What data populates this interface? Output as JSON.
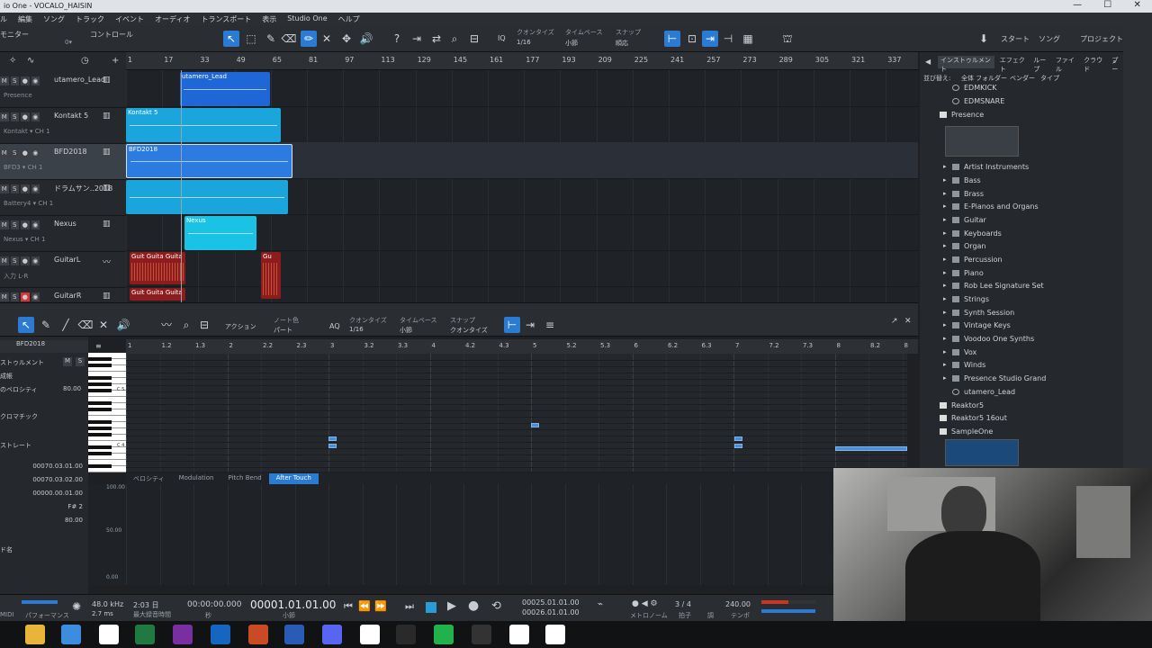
{
  "window": {
    "title": "io One - VOCALO_HAISIN"
  },
  "menu": [
    "ル",
    "編集",
    "ソング",
    "トラック",
    "イベント",
    "オーディオ",
    "トランスポート",
    "表示",
    "Studio One",
    "ヘルプ"
  ],
  "toolbar": {
    "monitor": "モニター",
    "control": "コントロール",
    "quantize_label": "クオンタイズ",
    "quantize_value": "1/16",
    "timebase_label": "タイムベース",
    "timebase_value": "小節",
    "snap_label": "スナップ",
    "snap_value": "順応",
    "start": "スタート",
    "song": "ソング",
    "project": "プロジェクト"
  },
  "arrange": {
    "ruler": [
      "1",
      "17",
      "33",
      "49",
      "65",
      "81",
      "97",
      "113",
      "129",
      "145",
      "161",
      "177",
      "193",
      "209",
      "225",
      "241",
      "257",
      "273",
      "289",
      "305",
      "321",
      "337"
    ],
    "tracks": [
      {
        "name": "utamero_Lead",
        "sub": "Presence"
      },
      {
        "name": "Kontakt 5",
        "sub": "Kontakt ▾   CH 1"
      },
      {
        "name": "BFD2018",
        "sub": "BFD3 ▾   CH 1"
      },
      {
        "name": "ドラムサン..2018",
        "sub": "Battery4 ▾   CH 1"
      },
      {
        "name": "Nexus",
        "sub": "Nexus ▾   CH 1"
      },
      {
        "name": "GuitarL",
        "sub": "入力 L-R"
      },
      {
        "name": "GuitarR",
        "sub": "標準"
      }
    ],
    "clips": [
      {
        "label": "utamero_Lead",
        "color": "#1f66d6"
      },
      {
        "label": "Kontakt 5",
        "color": "#1aa6dc"
      },
      {
        "label": "BFD2018",
        "color": "#2b7be0"
      },
      {
        "label": "",
        "color": "#1aa6dc"
      },
      {
        "label": "Nexus",
        "color": "#1ac2e6"
      },
      {
        "label": "Guit  Guita Guita",
        "color": "#8e1c1c"
      },
      {
        "label": "Gu",
        "color": "#8e1c1c"
      },
      {
        "label": "Guit  Guita Guita",
        "color": "#8e1c1c"
      }
    ]
  },
  "editor": {
    "action": "アクション",
    "note_color_label": "ノート色",
    "note_color_value": "パート",
    "quantize_label": "クオンタイズ",
    "quantize_value": "1/16",
    "timebase_label": "タイムベース",
    "timebase_value": "小節",
    "snap_label": "スナップ",
    "snap_value": "クオンタイズ",
    "track": "BFD2018",
    "left_rows": [
      "ストゥルメント",
      "成帳",
      "のベロシティ",
      "クロマチック",
      "ストレート",
      "00070.03.01.00",
      "00070.03.02.00",
      "00000.00.01.00",
      "F# 2",
      "80.00",
      "ド名"
    ],
    "velocity_value": "80.00",
    "ms_m": "M",
    "ms_s": "S",
    "ruler": [
      "1",
      "1.2",
      "1.3",
      "2",
      "2.2",
      "2.3",
      "3",
      "3.2",
      "3.3",
      "4",
      "4.2",
      "4.3",
      "5",
      "5.2",
      "5.3",
      "6",
      "6.2",
      "6.3",
      "7",
      "7.2",
      "7.3",
      "8",
      "8.2",
      "8"
    ],
    "piano_c5": "C 5",
    "piano_c4": "C 4",
    "tabs": [
      "ベロシティ",
      "Modulation",
      "Pitch Bend",
      "After Touch"
    ],
    "active_tab": "After Touch",
    "ctrl_labels": [
      "100.00",
      "50.00",
      "0.00"
    ]
  },
  "transport": {
    "midi": "MIDI",
    "performance": "パフォーマンス",
    "sample_rate": "48.0 kHz",
    "latency": "2.7 ms",
    "rec_time": "2:03 日",
    "rec_time_label": "最大録音時間",
    "time": "00:00:00.000",
    "time_label": "秒",
    "bars": "00001.01.01.00",
    "bars_label": "小節",
    "loop_l": "00025.01.01.00",
    "loop_r": "00026.01.01.00",
    "metronome": "メトロノーム",
    "signature": "3 / 4",
    "signature_label": "拍子",
    "key_label": "調",
    "tempo": "240.00",
    "tempo_label": "テンポ"
  },
  "browser": {
    "tabs": [
      "インストゥルメント",
      "エフェクト",
      "ループ",
      "ファイル",
      "クラウド",
      "プー"
    ],
    "active_tab": "インストゥルメント",
    "sort": [
      "並び替え:",
      "全体",
      "フォルダー",
      "ベンダー",
      "タイプ"
    ],
    "items": [
      {
        "label": "EDMKICK",
        "type": "preset",
        "indent": 1
      },
      {
        "label": "EDMSNARE",
        "type": "preset",
        "indent": 1
      },
      {
        "label": "Presence",
        "type": "instrument",
        "indent": 0
      },
      {
        "label": "Artist Instruments",
        "type": "folder",
        "indent": 1
      },
      {
        "label": "Bass",
        "type": "folder",
        "indent": 1
      },
      {
        "label": "Brass",
        "type": "folder",
        "indent": 1
      },
      {
        "label": "E-Pianos and Organs",
        "type": "folder",
        "indent": 1
      },
      {
        "label": "Guitar",
        "type": "folder",
        "indent": 1
      },
      {
        "label": "Keyboards",
        "type": "folder",
        "indent": 1
      },
      {
        "label": "Organ",
        "type": "folder",
        "indent": 1
      },
      {
        "label": "Percussion",
        "type": "folder",
        "indent": 1
      },
      {
        "label": "Piano",
        "type": "folder",
        "indent": 1
      },
      {
        "label": "Rob Lee Signature Set",
        "type": "folder",
        "indent": 1
      },
      {
        "label": "Strings",
        "type": "folder",
        "indent": 1
      },
      {
        "label": "Synth Session",
        "type": "folder",
        "indent": 1
      },
      {
        "label": "Vintage Keys",
        "type": "folder",
        "indent": 1
      },
      {
        "label": "Voodoo One Synths",
        "type": "folder",
        "indent": 1
      },
      {
        "label": "Vox",
        "type": "folder",
        "indent": 1
      },
      {
        "label": "Winds",
        "type": "folder",
        "indent": 1
      },
      {
        "label": "Presence Studio Grand",
        "type": "folder",
        "indent": 1
      },
      {
        "label": "utamero_Lead",
        "type": "preset",
        "indent": 1
      },
      {
        "label": "Reaktor5",
        "type": "instrument",
        "indent": 0
      },
      {
        "label": "Reaktor5 16out",
        "type": "instrument",
        "indent": 0
      },
      {
        "label": "SampleOne",
        "type": "instrument",
        "indent": 0
      }
    ]
  },
  "taskbar": [
    {
      "name": "explorer",
      "color": "#e8b43a"
    },
    {
      "name": "chrome",
      "color": "#3c8de0"
    },
    {
      "name": "studio-one",
      "color": "#ffffff"
    },
    {
      "name": "excel",
      "color": "#1f7a42"
    },
    {
      "name": "onenote",
      "color": "#7a2fa0"
    },
    {
      "name": "outlook",
      "color": "#1466c0"
    },
    {
      "name": "powerpoint",
      "color": "#c94a24"
    },
    {
      "name": "word",
      "color": "#2a5bb5"
    },
    {
      "name": "discord",
      "color": "#5865f2"
    },
    {
      "name": "studio-one-2",
      "color": "#ffffff"
    },
    {
      "name": "obs",
      "color": "#2a2a2a"
    },
    {
      "name": "line",
      "color": "#22b24c"
    },
    {
      "name": "clock",
      "color": "#333333"
    },
    {
      "name": "app-1",
      "color": "#ffffff"
    },
    {
      "name": "app-2",
      "color": "#ffffff"
    }
  ]
}
